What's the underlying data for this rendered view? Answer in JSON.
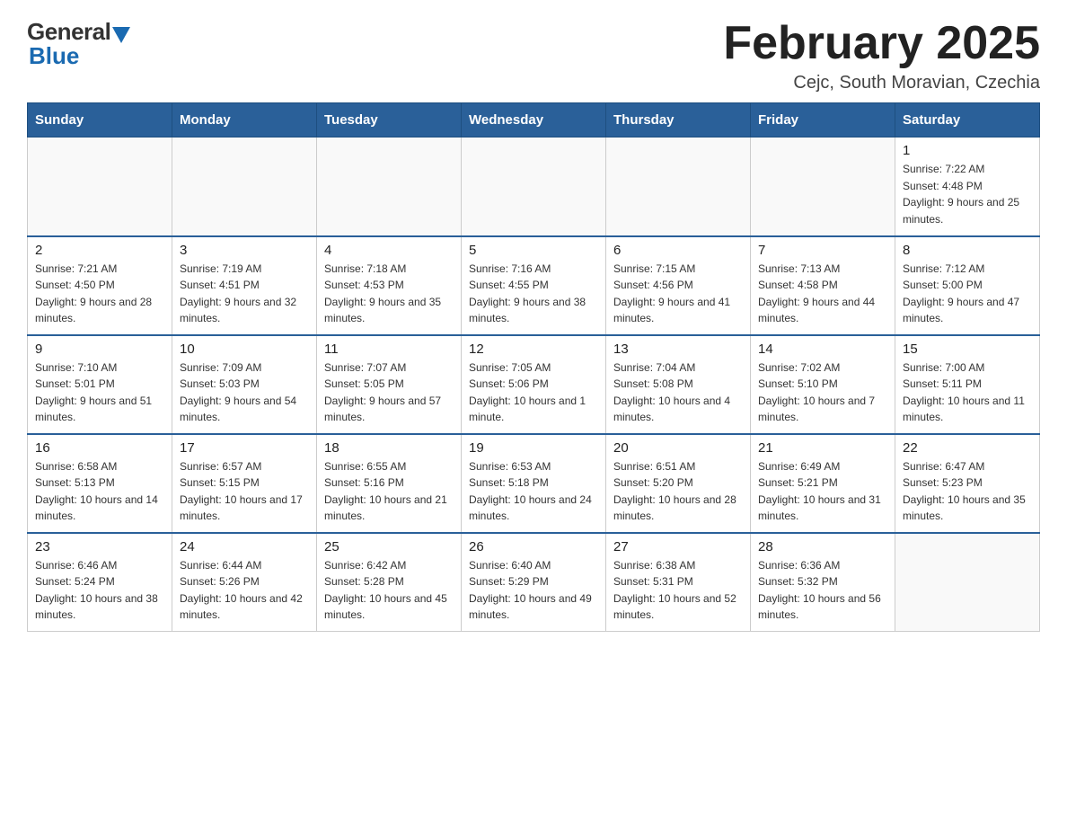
{
  "header": {
    "logo_general": "General",
    "logo_blue": "Blue",
    "month_title": "February 2025",
    "location": "Cejc, South Moravian, Czechia"
  },
  "days_of_week": [
    "Sunday",
    "Monday",
    "Tuesday",
    "Wednesday",
    "Thursday",
    "Friday",
    "Saturday"
  ],
  "weeks": [
    [
      {
        "day": "",
        "info": ""
      },
      {
        "day": "",
        "info": ""
      },
      {
        "day": "",
        "info": ""
      },
      {
        "day": "",
        "info": ""
      },
      {
        "day": "",
        "info": ""
      },
      {
        "day": "",
        "info": ""
      },
      {
        "day": "1",
        "info": "Sunrise: 7:22 AM\nSunset: 4:48 PM\nDaylight: 9 hours and 25 minutes."
      }
    ],
    [
      {
        "day": "2",
        "info": "Sunrise: 7:21 AM\nSunset: 4:50 PM\nDaylight: 9 hours and 28 minutes."
      },
      {
        "day": "3",
        "info": "Sunrise: 7:19 AM\nSunset: 4:51 PM\nDaylight: 9 hours and 32 minutes."
      },
      {
        "day": "4",
        "info": "Sunrise: 7:18 AM\nSunset: 4:53 PM\nDaylight: 9 hours and 35 minutes."
      },
      {
        "day": "5",
        "info": "Sunrise: 7:16 AM\nSunset: 4:55 PM\nDaylight: 9 hours and 38 minutes."
      },
      {
        "day": "6",
        "info": "Sunrise: 7:15 AM\nSunset: 4:56 PM\nDaylight: 9 hours and 41 minutes."
      },
      {
        "day": "7",
        "info": "Sunrise: 7:13 AM\nSunset: 4:58 PM\nDaylight: 9 hours and 44 minutes."
      },
      {
        "day": "8",
        "info": "Sunrise: 7:12 AM\nSunset: 5:00 PM\nDaylight: 9 hours and 47 minutes."
      }
    ],
    [
      {
        "day": "9",
        "info": "Sunrise: 7:10 AM\nSunset: 5:01 PM\nDaylight: 9 hours and 51 minutes."
      },
      {
        "day": "10",
        "info": "Sunrise: 7:09 AM\nSunset: 5:03 PM\nDaylight: 9 hours and 54 minutes."
      },
      {
        "day": "11",
        "info": "Sunrise: 7:07 AM\nSunset: 5:05 PM\nDaylight: 9 hours and 57 minutes."
      },
      {
        "day": "12",
        "info": "Sunrise: 7:05 AM\nSunset: 5:06 PM\nDaylight: 10 hours and 1 minute."
      },
      {
        "day": "13",
        "info": "Sunrise: 7:04 AM\nSunset: 5:08 PM\nDaylight: 10 hours and 4 minutes."
      },
      {
        "day": "14",
        "info": "Sunrise: 7:02 AM\nSunset: 5:10 PM\nDaylight: 10 hours and 7 minutes."
      },
      {
        "day": "15",
        "info": "Sunrise: 7:00 AM\nSunset: 5:11 PM\nDaylight: 10 hours and 11 minutes."
      }
    ],
    [
      {
        "day": "16",
        "info": "Sunrise: 6:58 AM\nSunset: 5:13 PM\nDaylight: 10 hours and 14 minutes."
      },
      {
        "day": "17",
        "info": "Sunrise: 6:57 AM\nSunset: 5:15 PM\nDaylight: 10 hours and 17 minutes."
      },
      {
        "day": "18",
        "info": "Sunrise: 6:55 AM\nSunset: 5:16 PM\nDaylight: 10 hours and 21 minutes."
      },
      {
        "day": "19",
        "info": "Sunrise: 6:53 AM\nSunset: 5:18 PM\nDaylight: 10 hours and 24 minutes."
      },
      {
        "day": "20",
        "info": "Sunrise: 6:51 AM\nSunset: 5:20 PM\nDaylight: 10 hours and 28 minutes."
      },
      {
        "day": "21",
        "info": "Sunrise: 6:49 AM\nSunset: 5:21 PM\nDaylight: 10 hours and 31 minutes."
      },
      {
        "day": "22",
        "info": "Sunrise: 6:47 AM\nSunset: 5:23 PM\nDaylight: 10 hours and 35 minutes."
      }
    ],
    [
      {
        "day": "23",
        "info": "Sunrise: 6:46 AM\nSunset: 5:24 PM\nDaylight: 10 hours and 38 minutes."
      },
      {
        "day": "24",
        "info": "Sunrise: 6:44 AM\nSunset: 5:26 PM\nDaylight: 10 hours and 42 minutes."
      },
      {
        "day": "25",
        "info": "Sunrise: 6:42 AM\nSunset: 5:28 PM\nDaylight: 10 hours and 45 minutes."
      },
      {
        "day": "26",
        "info": "Sunrise: 6:40 AM\nSunset: 5:29 PM\nDaylight: 10 hours and 49 minutes."
      },
      {
        "day": "27",
        "info": "Sunrise: 6:38 AM\nSunset: 5:31 PM\nDaylight: 10 hours and 52 minutes."
      },
      {
        "day": "28",
        "info": "Sunrise: 6:36 AM\nSunset: 5:32 PM\nDaylight: 10 hours and 56 minutes."
      },
      {
        "day": "",
        "info": ""
      }
    ]
  ]
}
